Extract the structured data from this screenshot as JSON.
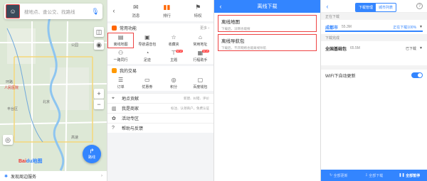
{
  "map": {
    "search_placeholder": "搜地点、查公交、找路线",
    "route_label": "路线",
    "logo_main": "Bai",
    "logo_sub": "du地图",
    "nearby_label": "发现周边服务",
    "labels": [
      "环路",
      "人民医院",
      "丰台区",
      "公园",
      "北京",
      "高速"
    ]
  },
  "menu": {
    "tabs": [
      {
        "icon": "envelope-icon",
        "label": "消息"
      },
      {
        "icon": "bar-chart-icon",
        "label": "排行"
      },
      {
        "icon": "flag-icon",
        "label": "特权"
      }
    ],
    "common": {
      "title": "常用功能",
      "more": "更多 ›",
      "items": [
        {
          "label": "离线地图",
          "highlight": true
        },
        {
          "label": "导航语音包"
        },
        {
          "label": "收藏夹"
        },
        {
          "label": "常用地址"
        },
        {
          "label": "一路同行"
        },
        {
          "label": "足迹"
        },
        {
          "label": "主题",
          "badge": "NEW"
        },
        {
          "label": "行程助手",
          "badge": "NEW"
        }
      ]
    },
    "trade": {
      "title": "我的交易",
      "items": [
        {
          "label": "订单"
        },
        {
          "label": "优惠券"
        },
        {
          "label": "积分"
        },
        {
          "label": "百度钱包"
        }
      ]
    },
    "rows": [
      {
        "label": "地点贡献",
        "sub": "新建、纠错、评价"
      },
      {
        "label": "我是商家",
        "sub": "标注、认领商户，免费认证"
      },
      {
        "label": "活动专区",
        "sub": ""
      },
      {
        "label": "帮助与反馈",
        "sub": ""
      }
    ]
  },
  "offline": {
    "title": "离线下载",
    "items": [
      {
        "title": "离线地图",
        "desc": "下载后，没网也能搜"
      },
      {
        "title": "离线导航包",
        "desc": "下载后，不开网络也能离线导航"
      }
    ]
  },
  "manager": {
    "tab_active": "下载管理",
    "tab_inactive": "城市列表",
    "downloading_group": "正在下载",
    "done_group": "下载完成",
    "downloading": {
      "name": "成都市",
      "size": "55.3M",
      "status": "正在下载100%",
      "progress": 1.0
    },
    "done": {
      "name": "全国基础包",
      "size": "65.5M",
      "status": "已下载"
    },
    "wifi_label": "WIFI下自动更新",
    "bottom": [
      "全部更新",
      "全部下载",
      "全部暂停"
    ]
  },
  "colors": {
    "accent": "#3385ff",
    "highlight": "#e44444"
  }
}
